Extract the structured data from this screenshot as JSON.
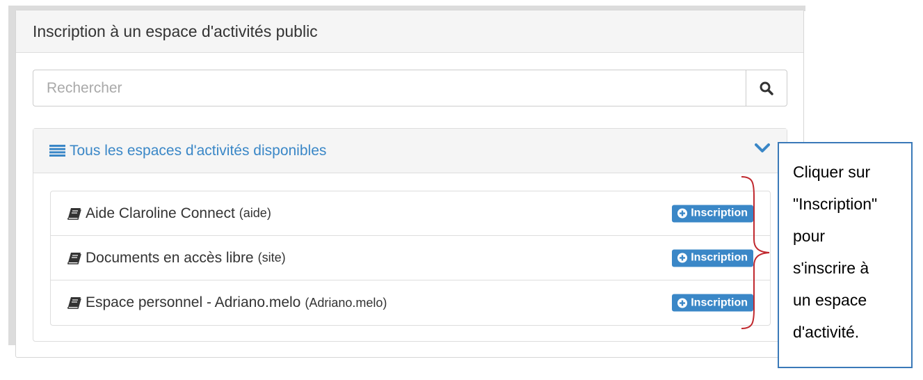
{
  "panel": {
    "title": "Inscription à un espace d'activités public"
  },
  "search": {
    "placeholder": "Rechercher",
    "value": "",
    "button_icon": "search-icon"
  },
  "workspaces": {
    "heading": "Tous les espaces d'activités disponibles",
    "heading_icon": "list-icon",
    "toggle_icon": "chevron-down-icon",
    "items": [
      {
        "name": "Aide Claroline Connect",
        "code": "(aide)",
        "icon": "book-icon",
        "button_label": "Inscription"
      },
      {
        "name": "Documents en accès libre",
        "code": "(site)",
        "icon": "book-icon",
        "button_label": "Inscription"
      },
      {
        "name": "Espace personnel - Adriano.melo",
        "code": "(Adriano.melo)",
        "icon": "book-icon",
        "button_label": "Inscription"
      }
    ]
  },
  "callout": {
    "lines": [
      "Cliquer sur",
      "\"Inscription\"",
      "pour",
      "s'inscrire à",
      "un espace",
      "d'activité."
    ]
  },
  "colors": {
    "accent": "#3a87c7",
    "brace": "#c0282e",
    "callout_border": "#3a79b8"
  }
}
